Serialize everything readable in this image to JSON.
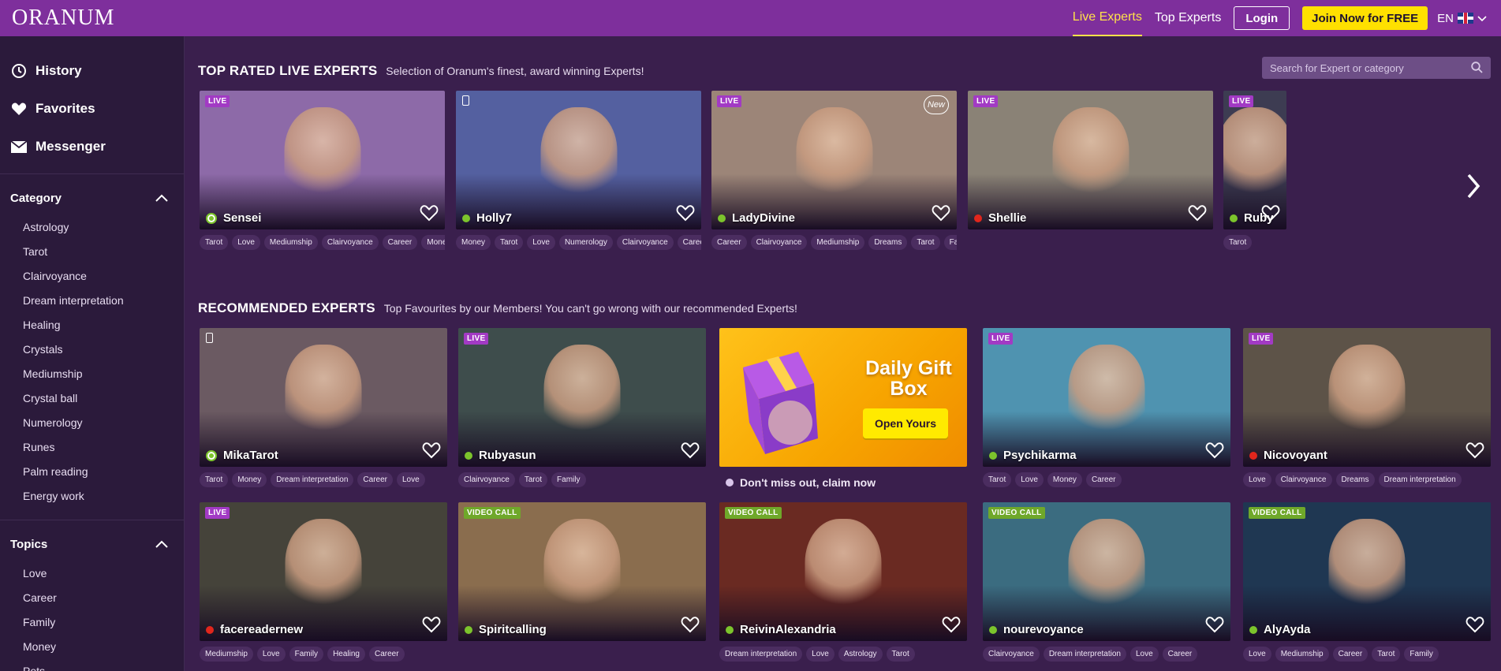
{
  "header": {
    "logo": "ORANUM",
    "nav": {
      "live_experts": "Live Experts",
      "top_experts": "Top Experts",
      "login": "Login",
      "join": "Join Now for FREE",
      "lang": "EN"
    }
  },
  "sidebar": {
    "main_items": [
      {
        "label": "History",
        "icon": "history-icon"
      },
      {
        "label": "Favorites",
        "icon": "heart-icon"
      },
      {
        "label": "Messenger",
        "icon": "envelope-icon"
      }
    ],
    "category": {
      "title": "Category",
      "items": [
        "Astrology",
        "Tarot",
        "Clairvoyance",
        "Dream interpretation",
        "Healing",
        "Crystals",
        "Mediumship",
        "Crystal ball",
        "Numerology",
        "Runes",
        "Palm reading",
        "Energy work"
      ]
    },
    "topics": {
      "title": "Topics",
      "items": [
        "Love",
        "Career",
        "Family",
        "Money",
        "Pets"
      ]
    }
  },
  "search": {
    "placeholder": "Search for Expert or category"
  },
  "top_rated": {
    "title_a": "TOP RATED",
    "title_b": "LIVE EXPERTS",
    "subtitle": "Selection of Oranum's finest, award winning Experts!",
    "cards": [
      {
        "name": "Sensei",
        "badge": "LIVE",
        "status": "green-ring",
        "tags": [
          "Tarot",
          "Love",
          "Mediumship",
          "Clairvoyance",
          "Career",
          "Money"
        ],
        "bg": "#8d6aa8"
      },
      {
        "name": "Holly7",
        "badge": "phone",
        "status": "green",
        "tags": [
          "Money",
          "Tarot",
          "Love",
          "Numerology",
          "Clairvoyance",
          "Career"
        ],
        "bg": "#5460a0"
      },
      {
        "name": "LadyDivine",
        "badge": "LIVE",
        "status": "green",
        "new": "New",
        "tags": [
          "Career",
          "Clairvoyance",
          "Mediumship",
          "Dreams",
          "Tarot",
          "Family"
        ],
        "bg": "#9c8578"
      },
      {
        "name": "Shellie",
        "badge": "LIVE",
        "status": "red",
        "tags": [],
        "bg": "#8a8276"
      },
      {
        "name": "Ruby",
        "badge": "LIVE",
        "status": "green",
        "tags": [
          "Tarot"
        ],
        "bg": "#3d3c52"
      }
    ]
  },
  "recommended": {
    "title_a": "RECOMMENDED",
    "title_b": "EXPERTS",
    "subtitle": "Top Favourites by our Members! You can't go wrong with our recommended Experts!",
    "row1": [
      {
        "name": "MikaTarot",
        "badge": "phone",
        "status": "green-ring",
        "tags": [
          "Tarot",
          "Money",
          "Dream interpretation",
          "Career",
          "Love"
        ],
        "bg": "#6b5a62"
      },
      {
        "name": "Rubyasun",
        "badge": "LIVE",
        "status": "green",
        "tags": [
          "Clairvoyance",
          "Tarot",
          "Family"
        ],
        "bg": "#3e4d4c"
      },
      {
        "name": "Psychikarma",
        "badge": "LIVE",
        "status": "green",
        "tags": [
          "Tarot",
          "Love",
          "Money",
          "Career"
        ],
        "bg": "#4f93b0"
      },
      {
        "name": "Nicovoyant",
        "badge": "LIVE",
        "status": "red",
        "tags": [
          "Love",
          "Clairvoyance",
          "Dreams",
          "Dream interpretation"
        ],
        "bg": "#5d5348"
      }
    ],
    "gift": {
      "title": "Daily Gift Box",
      "button": "Open Yours",
      "note": "Don't miss out, claim now"
    },
    "row2": [
      {
        "name": "facereadernew",
        "badge": "LIVE",
        "status": "red",
        "tags": [
          "Mediumship",
          "Love",
          "Family",
          "Healing",
          "Career"
        ],
        "bg": "#45433a"
      },
      {
        "name": "Spiritcalling",
        "badge": "VIDEO CALL",
        "status": "green",
        "tags": [],
        "bg": "#8a6d4e"
      },
      {
        "name": "ReivinAlexandria",
        "badge": "VIDEO CALL",
        "status": "green",
        "tags": [
          "Dream interpretation",
          "Love",
          "Astrology",
          "Tarot"
        ],
        "bg": "#6a2a22"
      },
      {
        "name": "nourevoyance",
        "badge": "VIDEO CALL",
        "status": "green",
        "tags": [
          "Clairvoyance",
          "Dream interpretation",
          "Love",
          "Career"
        ],
        "bg": "#3b6c80"
      },
      {
        "name": "AlyAyda",
        "badge": "VIDEO CALL",
        "status": "green",
        "tags": [
          "Love",
          "Mediumship",
          "Career",
          "Tarot",
          "Family"
        ],
        "bg": "#1f3752"
      }
    ]
  }
}
